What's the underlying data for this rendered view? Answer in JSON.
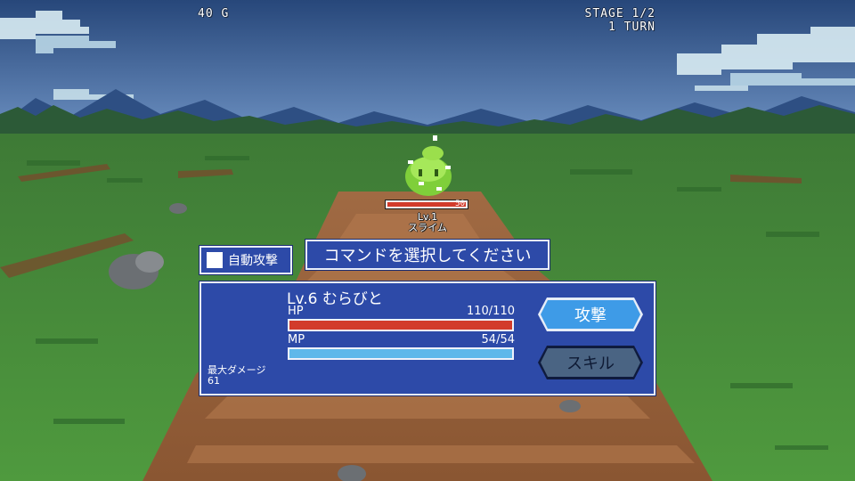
{
  "hud": {
    "gold": "40 G",
    "stage": "STAGE 1/2",
    "turn": "1 TURN"
  },
  "enemy": {
    "name": "スライム",
    "level": "Lv.1",
    "hp_value": "50",
    "hp_fraction": 1.0
  },
  "auto_attack": {
    "label": "自動攻撃",
    "checked": false
  },
  "prompt": "コマンドを選択してください",
  "player": {
    "name": "Lv.6 むらびと",
    "hp_label": "HP",
    "hp_value": "110/110",
    "hp_fraction": 1.0,
    "mp_label": "MP",
    "mp_value": "54/54",
    "mp_fraction": 1.0,
    "max_damage_label": "最大ダメージ",
    "max_damage_value": "61"
  },
  "commands": {
    "attack_label": "攻撃",
    "skill_label": "スキル"
  },
  "colors": {
    "panel": "#2d4aa8",
    "hp_bar": "#d23b2b",
    "mp_bar": "#5fb8ea",
    "attack_button": "#3e9be7",
    "skill_button_disabled": "#4a6483"
  }
}
